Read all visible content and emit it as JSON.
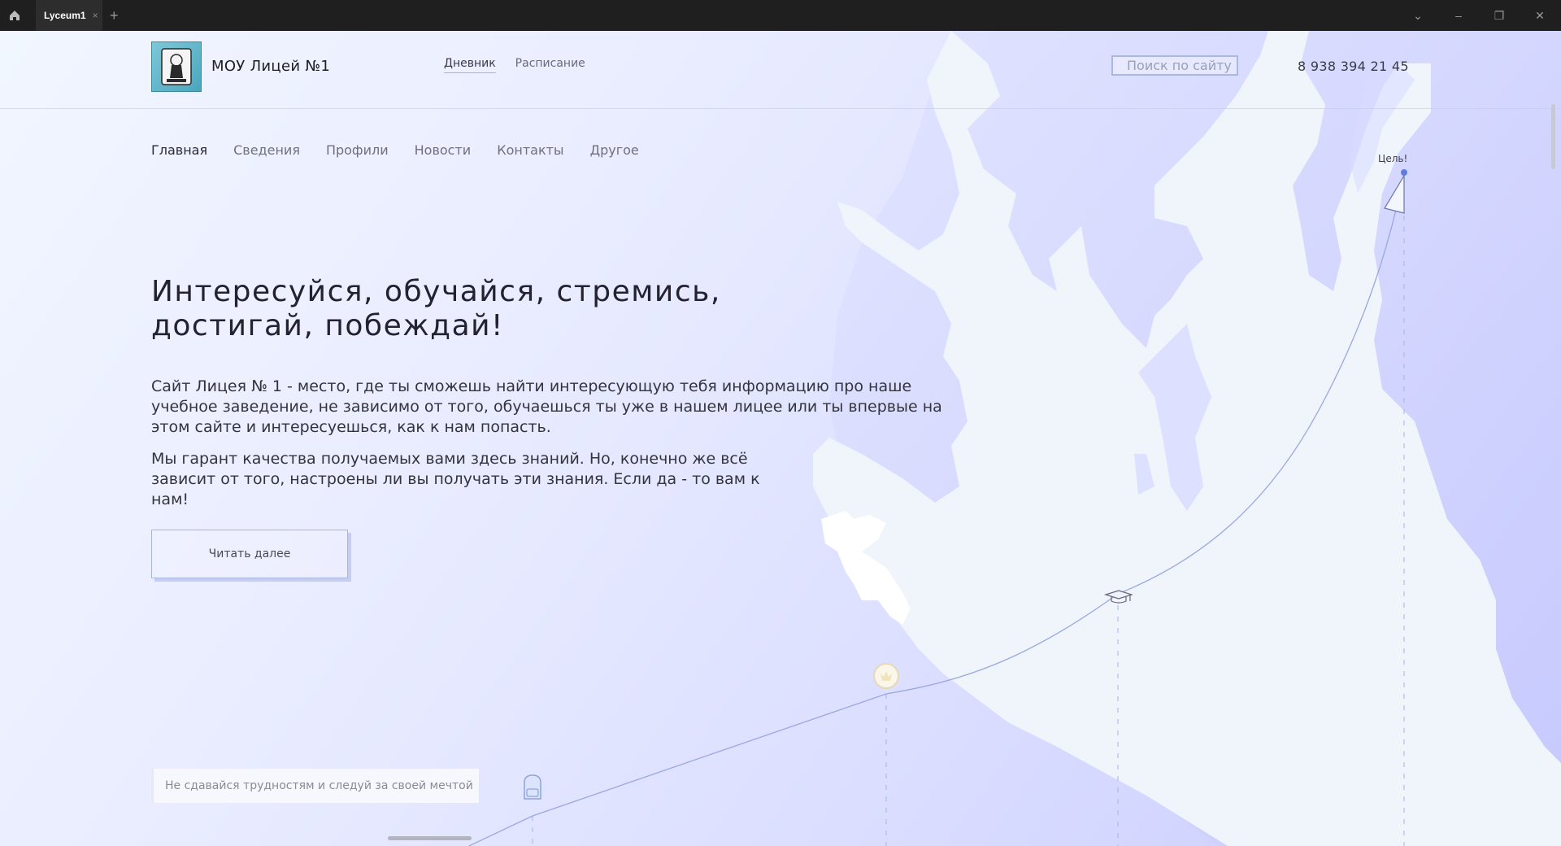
{
  "browser": {
    "tab_title": "Lyceum1",
    "tab_close": "×",
    "new_tab": "+",
    "controls": {
      "menu": "⌄",
      "minimize": "–",
      "restore": "❐",
      "close": "✕"
    }
  },
  "header": {
    "site_name": "МОУ Лицей №1",
    "top_links": [
      "Дневник",
      "Расписание"
    ],
    "search_placeholder": "Поиск по сайту",
    "phone": "8 938 394 21 45"
  },
  "nav": {
    "items": [
      "Главная",
      "Сведения",
      "Профили",
      "Новости",
      "Контакты",
      "Другое"
    ],
    "active": "Главная"
  },
  "hero": {
    "title_line1": "Интересуйся, обучайся, стремись,",
    "title_line2": "достигай, побеждай!",
    "paragraph1": "Сайт Лицея № 1 - место, где ты сможешь найти интересующую тебя информацию про наше учебное заведение, не зависимо от того, обучаешься ты уже в нашем лицее или ты впервые на этом сайте и интересуешься, как к нам попасть.",
    "paragraph2": "Мы гарант качества получаемых вами здесь знаний. Но, конечно же всё зависит от того, настроены ли вы получать эти знания. Если да - то вам к нам!",
    "read_more": "Читать далее"
  },
  "journey": {
    "goal_label": "Цель!",
    "motto": "Не сдавайся трудностям и следуй за своей мечтой",
    "milestone_icons": [
      "backpack-icon",
      "medal-icon",
      "graduation-cap-icon",
      "flag-icon"
    ]
  },
  "colors": {
    "accent": "#a9b7e6",
    "map_land": "#f0f5fc",
    "background": "#d9dcff"
  }
}
